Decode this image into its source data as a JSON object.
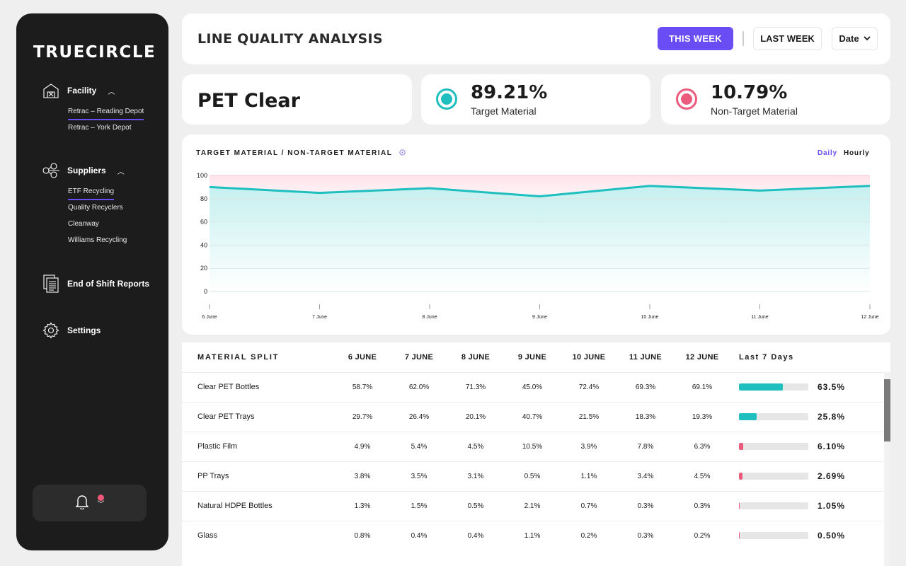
{
  "brand": "TRUECIRCLE",
  "sidebar": {
    "facility": {
      "label": "Facility",
      "items": [
        {
          "label": "Retrac – Reading Depot",
          "active": true
        },
        {
          "label": "Retrac – York Depot",
          "active": false
        }
      ]
    },
    "suppliers": {
      "label": "Suppliers",
      "items": [
        {
          "label": "ETF Recycling",
          "active": true
        },
        {
          "label": "Quality Recyclers",
          "active": false
        },
        {
          "label": "Cleanway",
          "active": false
        },
        {
          "label": "Williams Recycling",
          "active": false
        }
      ]
    },
    "reports": {
      "label": "End of Shift Reports"
    },
    "settings": {
      "label": "Settings"
    }
  },
  "header": {
    "title": "LINE QUALITY ANALYSIS",
    "this_week": "THIS WEEK",
    "last_week": "LAST WEEK",
    "date": "Date"
  },
  "kpis": {
    "material": "PET Clear",
    "target": {
      "value": "89.21%",
      "label": "Target Material",
      "color": "#1fbfbf"
    },
    "non_target": {
      "value": "10.79%",
      "label": "Non-Target Material",
      "color": "#ec5a7c"
    }
  },
  "chart": {
    "title": "TARGET MATERIAL / NON-TARGET MATERIAL",
    "toggle_daily": "Daily",
    "toggle_hourly": "Hourly"
  },
  "chart_data": {
    "type": "area",
    "title": "TARGET MATERIAL / NON-TARGET MATERIAL",
    "categories": [
      "6 June",
      "7 June",
      "8 June",
      "9 June",
      "10 June",
      "11 June",
      "12 June"
    ],
    "series": [
      {
        "values": [
          90,
          85,
          89,
          82,
          91,
          87,
          91
        ],
        "color": "#1fbfbf"
      }
    ],
    "yticks": [
      100,
      80,
      60,
      40,
      20,
      0
    ],
    "ylim": [
      0,
      100
    ],
    "grid": true
  },
  "table": {
    "headers": [
      "MATERIAL SPLIT",
      "6 JUNE",
      "7 JUNE",
      "8 JUNE",
      "9 JUNE",
      "10 JUNE",
      "11 JUNE",
      "12 JUNE",
      "Last 7 Days"
    ],
    "rows": [
      {
        "name": "Clear PET Bottles",
        "values": [
          "58.7%",
          "62.0%",
          "71.3%",
          "45.0%",
          "72.4%",
          "69.3%",
          "69.1%"
        ],
        "total": "63.5%",
        "fraction": 0.635,
        "color": "#1fbfbf"
      },
      {
        "name": "Clear PET Trays",
        "values": [
          "29.7%",
          "26.4%",
          "20.1%",
          "40.7%",
          "21.5%",
          "18.3%",
          "19.3%"
        ],
        "total": "25.8%",
        "fraction": 0.258,
        "color": "#1fbfbf"
      },
      {
        "name": "Plastic Film",
        "values": [
          "4.9%",
          "5.4%",
          "4.5%",
          "10.5%",
          "3.9%",
          "7.8%",
          "6.3%"
        ],
        "total": "6.10%",
        "fraction": 0.061,
        "color": "#ec5a7c"
      },
      {
        "name": "PP Trays",
        "values": [
          "3.8%",
          "3.5%",
          "3.1%",
          "0.5%",
          "1.1%",
          "3.4%",
          "4.5%"
        ],
        "total": "2.69%",
        "fraction": 0.0269,
        "color": "#ec5a7c"
      },
      {
        "name": "Natural HDPE Bottles",
        "values": [
          "1.3%",
          "1.5%",
          "0.5%",
          "2.1%",
          "0.7%",
          "0.3%",
          "0.3%"
        ],
        "total": "1.05%",
        "fraction": 0.0105,
        "color": "#ec5a7c"
      },
      {
        "name": "Glass",
        "values": [
          "0.8%",
          "0.4%",
          "0.4%",
          "1.1%",
          "0.2%",
          "0.3%",
          "0.2%"
        ],
        "total": "0.50%",
        "fraction": 0.005,
        "color": "#ec5a7c"
      }
    ]
  }
}
